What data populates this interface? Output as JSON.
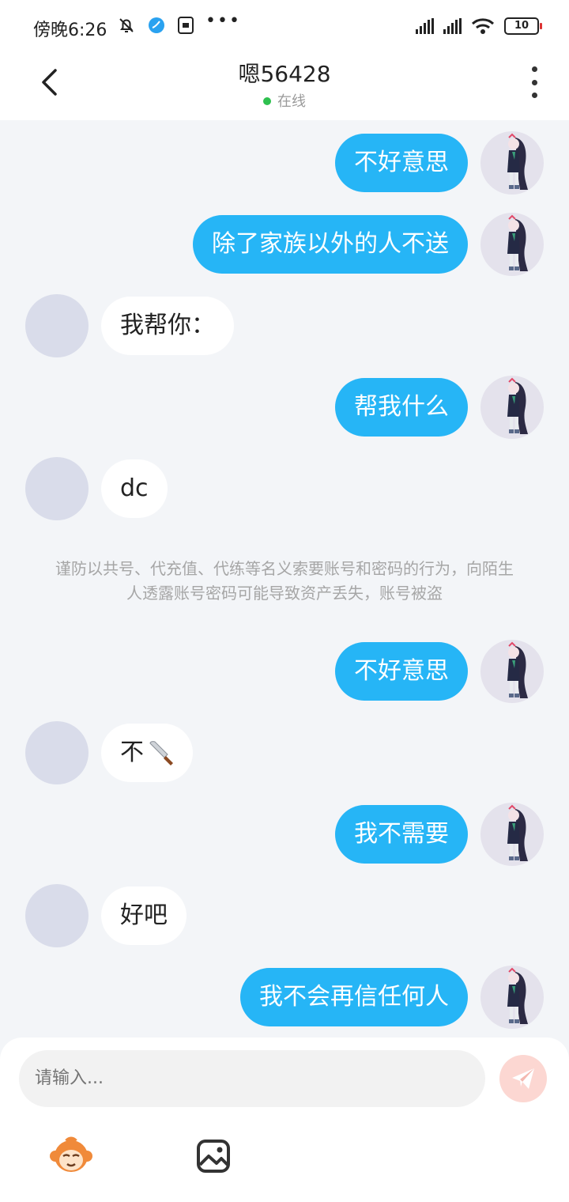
{
  "status_bar": {
    "time": "傍晚6:26",
    "battery": "10"
  },
  "header": {
    "title": "嗯56428",
    "status": "在线"
  },
  "messages": [
    {
      "side": "me",
      "text": "不好意思"
    },
    {
      "side": "me",
      "text": "除了家族以外的人不送"
    },
    {
      "side": "other",
      "text": "我帮你："
    },
    {
      "side": "me",
      "text": "帮我什么"
    },
    {
      "side": "other",
      "text": "dc"
    },
    {
      "side": "notice",
      "text": "谨防以共号、代充值、代练等名义索要账号和密码的行为，向陌生人透露账号密码可能导致资产丢失，账号被盗"
    },
    {
      "side": "me",
      "text": "不好意思"
    },
    {
      "side": "other",
      "text": "不",
      "emoji": "knife"
    },
    {
      "side": "me",
      "text": "我不需要"
    },
    {
      "side": "other",
      "text": "好吧"
    },
    {
      "side": "me",
      "text": "我不会再信任何人"
    }
  ],
  "composer": {
    "placeholder": "请输入..."
  },
  "colors": {
    "my_bubble": "#26b5f6",
    "other_bubble": "#ffffff",
    "online_dot": "#2ec04f"
  }
}
